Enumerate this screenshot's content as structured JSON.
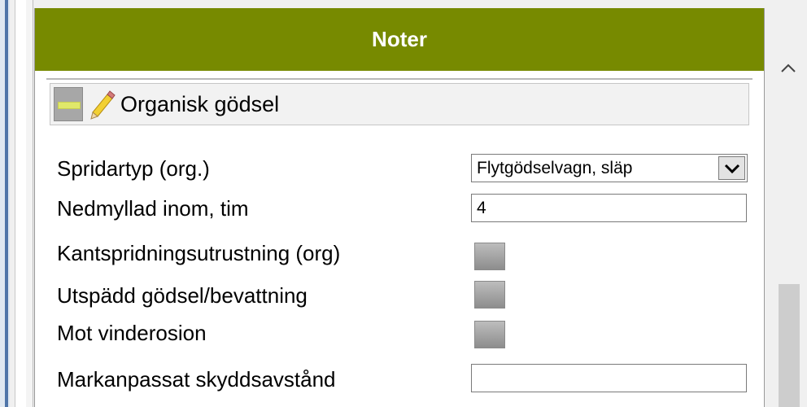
{
  "header": {
    "title": "Noter"
  },
  "section": {
    "title": "Organisk gödsel"
  },
  "fields": {
    "spridartyp": {
      "label": "Spridartyp (org.)",
      "value": "Flytgödselvagn, släp"
    },
    "nedmyllad": {
      "label": "Nedmyllad inom, tim",
      "value": "4"
    },
    "kantspridning": {
      "label": "Kantspridningsutrustning (org)"
    },
    "utspadd": {
      "label": "Utspädd gödsel/bevattning"
    },
    "vinderosion": {
      "label": "Mot vinderosion"
    },
    "skyddsavstand": {
      "label": "Markanpassat skyddsavstånd",
      "value": ""
    }
  },
  "colors": {
    "header_bg": "#778a00",
    "accent_blue": "#4f75a9"
  },
  "icons": {
    "collapse": "minus-icon",
    "edit": "pencil-icon",
    "dropdown": "chevron-down-icon",
    "scroll_up": "chevron-up-icon"
  }
}
